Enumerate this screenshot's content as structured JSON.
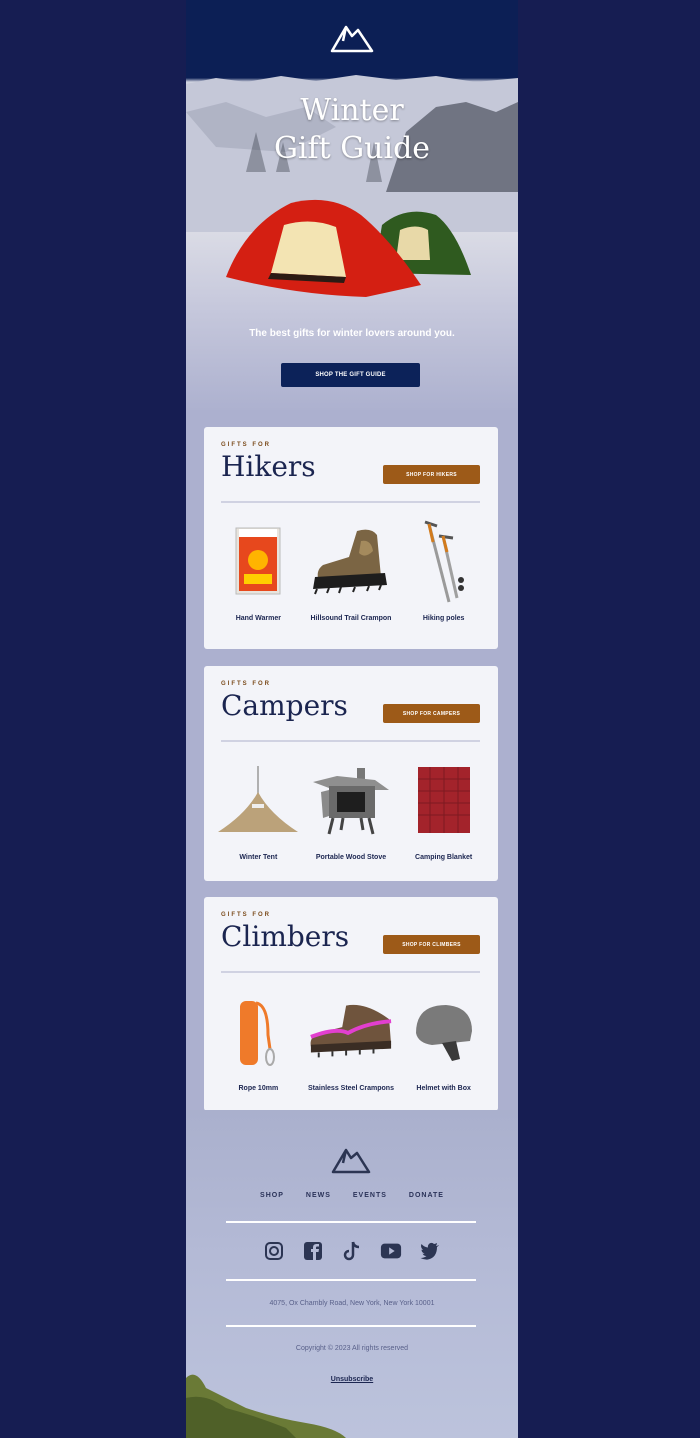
{
  "colors": {
    "page_bg": "#161d52",
    "hero_sky": "#0c1f55",
    "primary_button": "#0c2259",
    "accent_button": "#9d5a18",
    "card_bg": "#f3f4f9",
    "heading": "#1b2550"
  },
  "header": {
    "logo_icon": "mountain-logo-icon"
  },
  "hero": {
    "title_line1": "Winter",
    "title_line2": "Gift Guide",
    "subtitle": "The best gifts for winter lovers around you.",
    "cta_label": "SHOP THE GIFT GUIDE",
    "image": "tents-in-snow"
  },
  "sections": [
    {
      "eyebrow": "GIFTS FOR",
      "title": "Hikers",
      "button_label": "SHOP FOR HIKERS",
      "items": [
        {
          "name": "Hand Warmer",
          "image": "hand-warmer"
        },
        {
          "name": "Hillsound Trail Crampon",
          "image": "boot-with-crampon"
        },
        {
          "name": "Hiking poles",
          "image": "hiking-poles"
        }
      ]
    },
    {
      "eyebrow": "GIFTS FOR",
      "title": "Campers",
      "button_label": "SHOP FOR CAMPERS",
      "items": [
        {
          "name": "Winter Tent",
          "image": "winter-tent"
        },
        {
          "name": "Portable Wood Stove",
          "image": "wood-stove"
        },
        {
          "name": "Camping Blanket",
          "image": "camping-blanket"
        }
      ]
    },
    {
      "eyebrow": "GIFTS FOR",
      "title": "Climbers",
      "button_label": "SHOP FOR CLIMBERS",
      "items": [
        {
          "name": "Rope 10mm",
          "image": "climbing-rope"
        },
        {
          "name": "Stainless Steel Crampons",
          "image": "boot-with-crampons"
        },
        {
          "name": "Helmet with Box",
          "image": "climbing-helmet"
        }
      ]
    }
  ],
  "footer": {
    "nav": [
      "SHOP",
      "NEWS",
      "EVENTS",
      "DONATE"
    ],
    "social": [
      "instagram",
      "facebook",
      "tiktok",
      "youtube",
      "twitter"
    ],
    "address": "4075, Ox Chambly Road, New York, New York 10001",
    "copyright": "Copyright © 2023 All rights reserved",
    "unsubscribe": "Unsubscribe"
  }
}
